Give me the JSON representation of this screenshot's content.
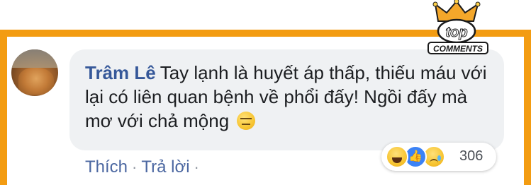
{
  "logo": {
    "top": "top",
    "bottom": "COMMENTS",
    "colors": {
      "crown": "#f4a72a",
      "badge": "#ffffff",
      "outline": "#1b1b1b"
    }
  },
  "comment": {
    "author": "Trâm Lê",
    "text": "Tay lạnh là huyết áp thấp, thiếu máu với lại có liên quan bệnh về phổi đấy! Ngồi đấy mà mơ với chả mộng",
    "emoji": "neutral-face-icon"
  },
  "actions": {
    "like": "Thích",
    "sep1": "·",
    "reply": "Trả lời",
    "sep2": "·"
  },
  "reactions": {
    "icons": [
      "haha-icon",
      "like-icon",
      "sad-icon"
    ],
    "count": "306"
  },
  "colors": {
    "frame": "#f39c12",
    "bubble": "#eff1f3",
    "author": "#365899",
    "action": "#4b67a1"
  }
}
